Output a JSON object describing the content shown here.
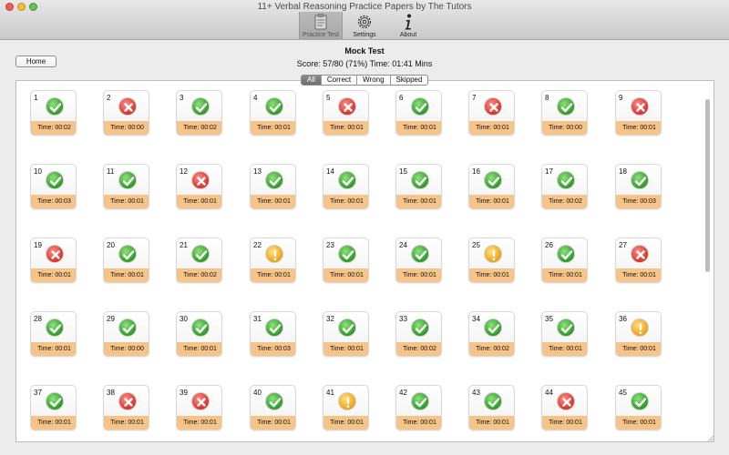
{
  "window": {
    "title": "11+ Verbal Reasoning Practice Papers by The Tutors"
  },
  "toolbar": [
    {
      "label": "Practice Test",
      "icon": "clipboard-icon",
      "active": true
    },
    {
      "label": "Settings",
      "icon": "gear-icon",
      "active": false
    },
    {
      "label": "About",
      "icon": "info-icon",
      "active": false
    }
  ],
  "header": {
    "home_label": "Home",
    "title": "Mock Test",
    "score_line": "Score: 57/80 (71%) Time: 01:41 Mins"
  },
  "filters": [
    {
      "label": "All",
      "active": true
    },
    {
      "label": "Correct",
      "active": false
    },
    {
      "label": "Wrong",
      "active": false
    },
    {
      "label": "Skipped",
      "active": false
    }
  ],
  "colors": {
    "correct": "#2f9b25",
    "wrong": "#d9322a",
    "skipped": "#f0a11b",
    "time_strip": "#f6c388"
  },
  "questions": [
    {
      "n": "1",
      "status": "correct",
      "time": "Time: 00:02"
    },
    {
      "n": "2",
      "status": "wrong",
      "time": "Time: 00:00"
    },
    {
      "n": "3",
      "status": "correct",
      "time": "Time: 00:02"
    },
    {
      "n": "4",
      "status": "correct",
      "time": "Time: 00:01"
    },
    {
      "n": "5",
      "status": "wrong",
      "time": "Time: 00:01"
    },
    {
      "n": "6",
      "status": "correct",
      "time": "Time: 00:01"
    },
    {
      "n": "7",
      "status": "wrong",
      "time": "Time: 00:01"
    },
    {
      "n": "8",
      "status": "correct",
      "time": "Time: 00:00"
    },
    {
      "n": "9",
      "status": "wrong",
      "time": "Time: 00:01"
    },
    {
      "n": "10",
      "status": "correct",
      "time": "Time: 00:03"
    },
    {
      "n": "11",
      "status": "correct",
      "time": "Time: 00:01"
    },
    {
      "n": "12",
      "status": "wrong",
      "time": "Time: 00:01"
    },
    {
      "n": "13",
      "status": "correct",
      "time": "Time: 00:01"
    },
    {
      "n": "14",
      "status": "correct",
      "time": "Time: 00:01"
    },
    {
      "n": "15",
      "status": "correct",
      "time": "Time: 00:01"
    },
    {
      "n": "16",
      "status": "correct",
      "time": "Time: 00:01"
    },
    {
      "n": "17",
      "status": "correct",
      "time": "Time: 00:02"
    },
    {
      "n": "18",
      "status": "correct",
      "time": "Time: 00:03"
    },
    {
      "n": "19",
      "status": "wrong",
      "time": "Time: 00:01"
    },
    {
      "n": "20",
      "status": "correct",
      "time": "Time: 00:01"
    },
    {
      "n": "21",
      "status": "correct",
      "time": "Time: 00:02"
    },
    {
      "n": "22",
      "status": "skipped",
      "time": "Time: 00:01"
    },
    {
      "n": "23",
      "status": "correct",
      "time": "Time: 00:01"
    },
    {
      "n": "24",
      "status": "correct",
      "time": "Time: 00:01"
    },
    {
      "n": "25",
      "status": "skipped",
      "time": "Time: 00:01"
    },
    {
      "n": "26",
      "status": "correct",
      "time": "Time: 00:01"
    },
    {
      "n": "27",
      "status": "wrong",
      "time": "Time: 00:01"
    },
    {
      "n": "28",
      "status": "correct",
      "time": "Time: 00:01"
    },
    {
      "n": "29",
      "status": "correct",
      "time": "Time: 00:00"
    },
    {
      "n": "30",
      "status": "correct",
      "time": "Time: 00:01"
    },
    {
      "n": "31",
      "status": "correct",
      "time": "Time: 00:03"
    },
    {
      "n": "32",
      "status": "correct",
      "time": "Time: 00:01"
    },
    {
      "n": "33",
      "status": "correct",
      "time": "Time: 00:02"
    },
    {
      "n": "34",
      "status": "correct",
      "time": "Time: 00:02"
    },
    {
      "n": "35",
      "status": "correct",
      "time": "Time: 00:01"
    },
    {
      "n": "36",
      "status": "skipped",
      "time": "Time: 00:01"
    },
    {
      "n": "37",
      "status": "correct",
      "time": "Time: 00:01"
    },
    {
      "n": "38",
      "status": "wrong",
      "time": "Time: 00:01"
    },
    {
      "n": "39",
      "status": "wrong",
      "time": "Time: 00:01"
    },
    {
      "n": "40",
      "status": "correct",
      "time": "Time: 00:01"
    },
    {
      "n": "41",
      "status": "skipped",
      "time": "Time: 00:01"
    },
    {
      "n": "42",
      "status": "correct",
      "time": "Time: 00:01"
    },
    {
      "n": "43",
      "status": "correct",
      "time": "Time: 00:01"
    },
    {
      "n": "44",
      "status": "wrong",
      "time": "Time: 00:01"
    },
    {
      "n": "45",
      "status": "correct",
      "time": "Time: 00:01"
    }
  ]
}
